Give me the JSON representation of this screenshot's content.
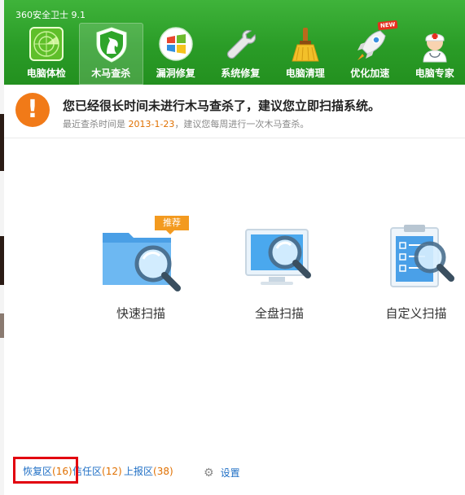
{
  "window": {
    "title": "360安全卫士 9.1"
  },
  "nav": {
    "items": [
      {
        "label": "电脑体检",
        "icon": "radar-icon"
      },
      {
        "label": "木马查杀",
        "icon": "horse-shield-icon",
        "active": true
      },
      {
        "label": "漏洞修复",
        "icon": "windows-logo-icon"
      },
      {
        "label": "系统修复",
        "icon": "wrench-icon"
      },
      {
        "label": "电脑清理",
        "icon": "broom-icon"
      },
      {
        "label": "优化加速",
        "icon": "rocket-icon",
        "badge": "NEW"
      },
      {
        "label": "电脑专家",
        "icon": "doctor-icon"
      }
    ]
  },
  "alert": {
    "icon": "exclamation-icon",
    "title": "您已经很长时间未进行木马查杀了，建议您立即扫描系统。",
    "sub_prefix": "最近查杀时间是 ",
    "date": "2013-1-23",
    "sub_suffix": "，建议您每周进行一次木马查杀。"
  },
  "scan": {
    "recommend_badge": "推荐",
    "quick": "快速扫描",
    "full": "全盘扫描",
    "custom": "自定义扫描"
  },
  "footer": {
    "restore_label": "恢复区",
    "restore_count": "(16)",
    "trust_label": "信任区",
    "trust_count": "(12)",
    "report_label": "上报区",
    "report_count": "(38)",
    "settings_label": "设置"
  },
  "colors": {
    "header_green": "#2a9c27",
    "alert_orange": "#f17a18",
    "link_blue": "#1f6fc5",
    "count_orange": "#e07000",
    "highlight_red": "#e2000f"
  }
}
